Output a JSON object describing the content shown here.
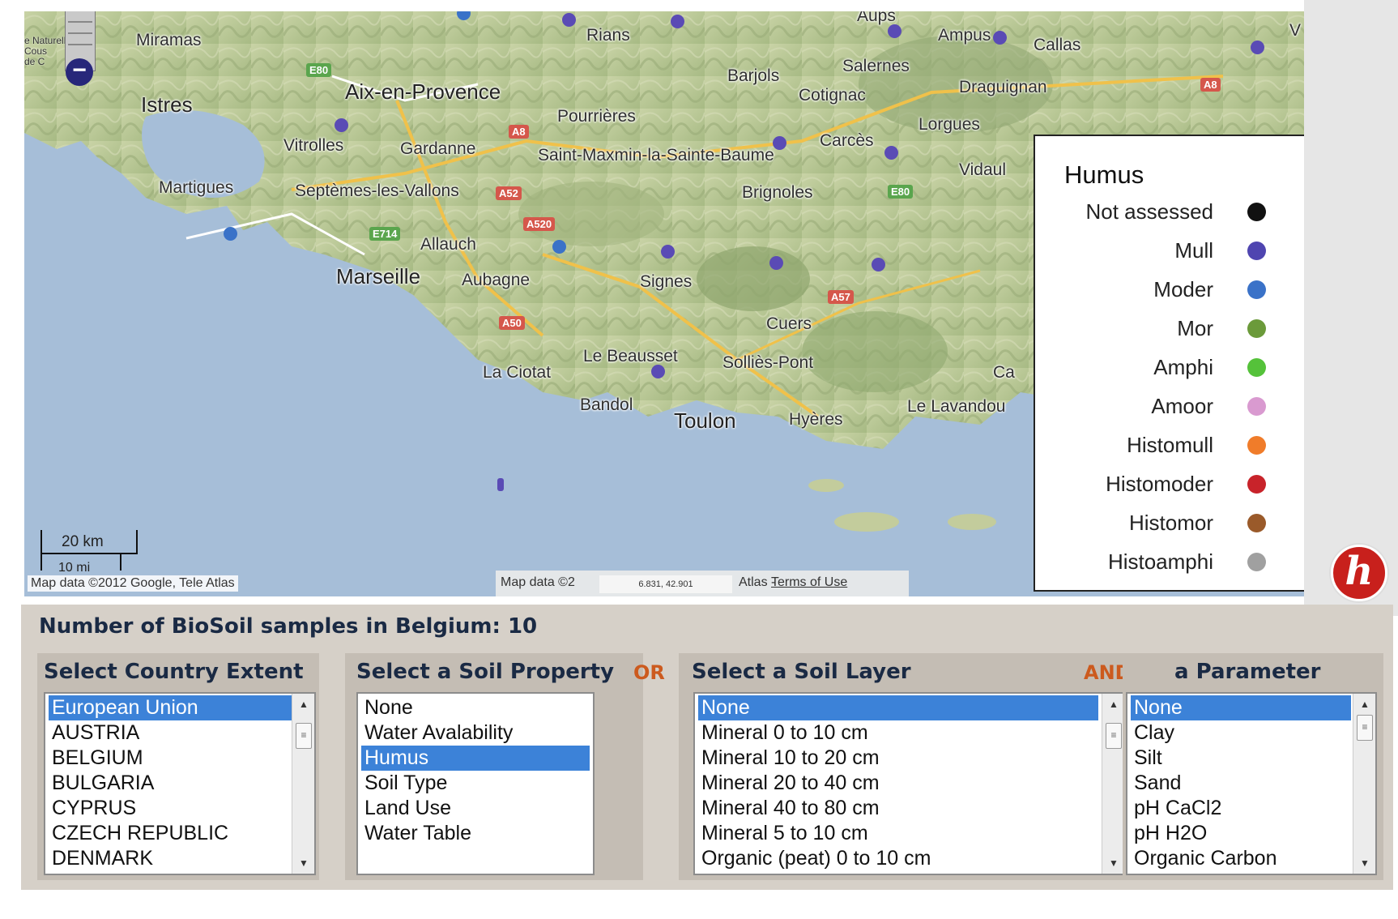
{
  "map": {
    "places": [
      "Miramas",
      "Istres",
      "Aix-en-Provence",
      "Vitrolles",
      "Gardanne",
      "Martigues",
      "Septèmes-les-Vallons",
      "Allauch",
      "Marseille",
      "Aubagne",
      "La Ciotat",
      "Bandol",
      "Toulon",
      "Hyères",
      "Le Beausset",
      "Signes",
      "Cuers",
      "Solliès-Pont",
      "Brignoles",
      "Saint-Maxmin-la-Sainte-Baume",
      "Pourrières",
      "Rians",
      "Barjols",
      "Cotignac",
      "Salernes",
      "Carcès",
      "Lorgues",
      "Draguignan",
      "Ampus",
      "Callas",
      "Vidaul",
      "Le Lavandou",
      "Ca",
      "Aups",
      "V"
    ],
    "road_shields": [
      "E80",
      "A8",
      "A52",
      "A520",
      "E714",
      "A50",
      "A57",
      "E80",
      "A8"
    ],
    "park_label": "e Naturelle\nCous\nde C",
    "zoom_minus": "−",
    "scale_km": "20 km",
    "scale_mi": "10 mi",
    "attribution_left": "Map data ©2012 Google, Tele Atlas",
    "attribution_mid_prefix": "Map data ©2",
    "coordinates": "6.831, 42.901",
    "attribution_mid_suffix": "Atlas -",
    "terms": "Terms of Use"
  },
  "legend": {
    "title": "Humus",
    "items": [
      {
        "label": "Not assessed",
        "color": "#111111"
      },
      {
        "label": "Mull",
        "color": "#4f45b0"
      },
      {
        "label": "Moder",
        "color": "#3a72c8"
      },
      {
        "label": "Mor",
        "color": "#6b9a3a"
      },
      {
        "label": "Amphi",
        "color": "#55c23a"
      },
      {
        "label": "Amoor",
        "color": "#d99ad0"
      },
      {
        "label": "Histomull",
        "color": "#f07c2a"
      },
      {
        "label": "Histomoder",
        "color": "#c8232a"
      },
      {
        "label": "Histomor",
        "color": "#9a5a2a"
      },
      {
        "label": "Histoamphi",
        "color": "#a0a0a0"
      }
    ]
  },
  "logo": "h",
  "panel": {
    "samples_text": "Number of BioSoil samples in Belgium: 10",
    "country": {
      "header": "Select Country Extent",
      "options": [
        "European Union",
        "AUSTRIA",
        "BELGIUM",
        "BULGARIA",
        "CYPRUS",
        "CZECH REPUBLIC",
        "DENMARK"
      ],
      "selected": "European Union"
    },
    "property": {
      "header": "Select a Soil Property",
      "options": [
        "None",
        "Water Avalability",
        "Humus",
        "Soil Type",
        "Land Use",
        "Water Table"
      ],
      "selected": "Humus"
    },
    "or_label": "OR",
    "layer": {
      "header": "Select a Soil Layer",
      "options": [
        "None",
        "Mineral 0 to 10 cm",
        "Mineral 10 to 20 cm",
        "Mineral 20 to 40 cm",
        "Mineral 40 to 80 cm",
        "Mineral 5 to 10 cm",
        "Organic (peat) 0 to 10 cm"
      ],
      "selected": "None"
    },
    "and_label": "AND",
    "parameter": {
      "header": "a Parameter",
      "options": [
        "None",
        "Clay",
        "Silt",
        "Sand",
        "pH CaCl2",
        "pH H2O",
        "Organic Carbon"
      ],
      "selected": "None"
    }
  }
}
